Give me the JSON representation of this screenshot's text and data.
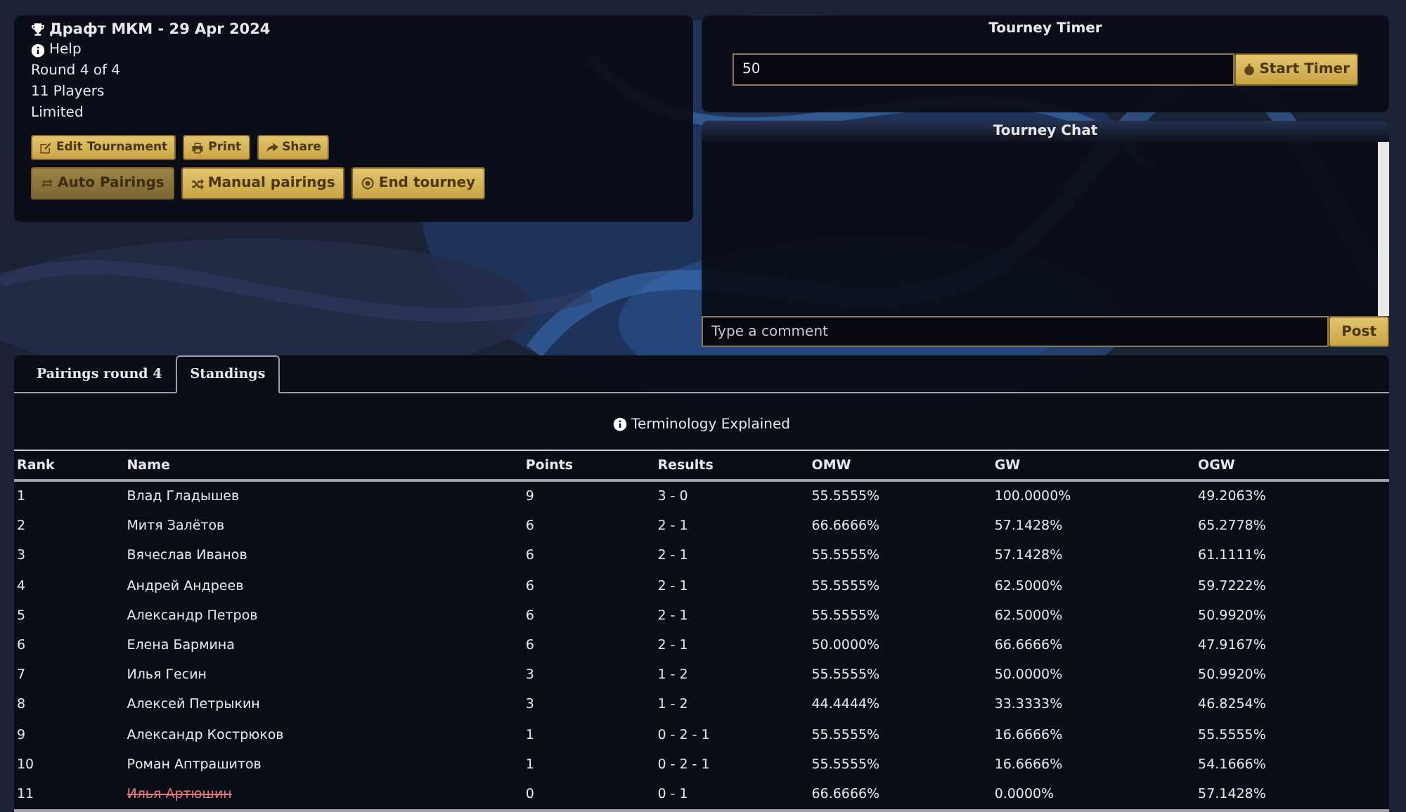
{
  "tournament": {
    "title": "Драфт МКМ - 29 Apr 2024",
    "help": "Help",
    "round": "Round 4 of 4",
    "players": "11 Players",
    "format": "Limited",
    "small_buttons": [
      {
        "kind": "edit",
        "label": "Edit Tournament"
      },
      {
        "kind": "print",
        "label": "Print"
      },
      {
        "kind": "share",
        "label": "Share"
      }
    ],
    "buttons": [
      {
        "kind": "auto",
        "label": "Auto Pairings",
        "selected": true
      },
      {
        "kind": "manual",
        "label": "Manual pairings",
        "selected": false
      },
      {
        "kind": "end",
        "label": "End tourney",
        "selected": false
      }
    ]
  },
  "timer": {
    "title": "Tourney Timer",
    "value": "50",
    "button": "Start Timer"
  },
  "chat": {
    "title": "Tourney Chat",
    "placeholder": "Type a comment",
    "button": "Post"
  },
  "tabs": [
    {
      "label": "Pairings round 4",
      "selected": false
    },
    {
      "label": "Standings",
      "selected": true
    }
  ],
  "terminology": "Terminology Explained",
  "table": {
    "columns": [
      "Rank",
      "Name",
      "Points",
      "Results",
      "OMW",
      "GW",
      "OGW"
    ],
    "rows": [
      {
        "cells": [
          "1",
          "Влад Гладышев",
          "9",
          "3 - 0",
          "55.5555%",
          "100.0000%",
          "49.2063%"
        ],
        "dropped": false
      },
      {
        "cells": [
          "2",
          "Митя Залётов",
          "6",
          "2 - 1",
          "66.6666%",
          "57.1428%",
          "65.2778%"
        ],
        "dropped": false
      },
      {
        "cells": [
          "3",
          "Вячеслав Иванов",
          "6",
          "2 - 1",
          "55.5555%",
          "57.1428%",
          "61.1111%"
        ],
        "dropped": false
      },
      {
        "cells": [
          "4",
          "Андрей Андреев",
          "6",
          "2 - 1",
          "55.5555%",
          "62.5000%",
          "59.7222%"
        ],
        "dropped": false
      },
      {
        "cells": [
          "5",
          "Александр Петров",
          "6",
          "2 - 1",
          "55.5555%",
          "62.5000%",
          "50.9920%"
        ],
        "dropped": false
      },
      {
        "cells": [
          "6",
          "Елена Бармина",
          "6",
          "2 - 1",
          "50.0000%",
          "66.6666%",
          "47.9167%"
        ],
        "dropped": false
      },
      {
        "cells": [
          "7",
          "Илья Гесин",
          "3",
          "1 - 2",
          "55.5555%",
          "50.0000%",
          "50.9920%"
        ],
        "dropped": false
      },
      {
        "cells": [
          "8",
          "Алексей Петрыкин",
          "3",
          "1 - 2",
          "44.4444%",
          "33.3333%",
          "46.8254%"
        ],
        "dropped": false
      },
      {
        "cells": [
          "9",
          "Александр Кострюков",
          "1",
          "0 - 2 - 1",
          "55.5555%",
          "16.6666%",
          "55.5555%"
        ],
        "dropped": false
      },
      {
        "cells": [
          "10",
          "Роман Аптрашитов",
          "1",
          "0 - 2 - 1",
          "55.5555%",
          "16.6666%",
          "54.1666%"
        ],
        "dropped": false
      },
      {
        "cells": [
          "11",
          "Илья Артюшин",
          "0",
          "0 - 1",
          "66.6666%",
          "0.0000%",
          "57.1428%"
        ],
        "dropped": true
      }
    ]
  }
}
